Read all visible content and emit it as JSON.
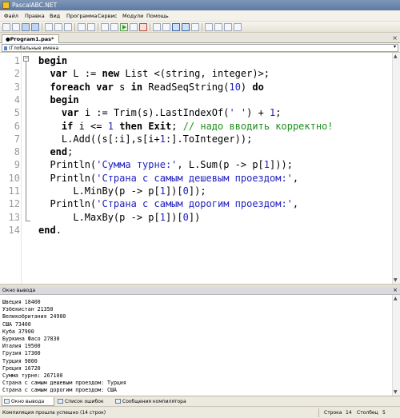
{
  "window": {
    "title": "PascalABC.NET"
  },
  "menu": [
    "Файл",
    "Правка",
    "Вид",
    "Программа",
    "Сервис",
    "Модули",
    "Помощь"
  ],
  "tab": {
    "label": "●Program1.pas*",
    "close": "×"
  },
  "scope": {
    "label": "(Глобальные имена",
    "arrow": "▾"
  },
  "editor": {
    "line_numbers": [
      "1",
      "2",
      "3",
      "4",
      "5",
      "6",
      "7",
      "8",
      "9",
      "10",
      "11",
      "12",
      "13",
      "14"
    ],
    "lines": [
      [
        {
          "t": "begin",
          "c": "kw"
        }
      ],
      [
        {
          "t": "  "
        },
        {
          "t": "var",
          "c": "kw"
        },
        {
          "t": " L := "
        },
        {
          "t": "new",
          "c": "kw"
        },
        {
          "t": " List <(string, integer)>;"
        }
      ],
      [
        {
          "t": "  "
        },
        {
          "t": "foreach",
          "c": "kw"
        },
        {
          "t": " "
        },
        {
          "t": "var",
          "c": "kw"
        },
        {
          "t": " s "
        },
        {
          "t": "in",
          "c": "kw"
        },
        {
          "t": " ReadSeqString("
        },
        {
          "t": "10",
          "c": "num"
        },
        {
          "t": ") "
        },
        {
          "t": "do",
          "c": "kw"
        }
      ],
      [
        {
          "t": "  "
        },
        {
          "t": "begin",
          "c": "kw"
        }
      ],
      [
        {
          "t": "    "
        },
        {
          "t": "var",
          "c": "kw"
        },
        {
          "t": " i := Trim(s).LastIndexOf("
        },
        {
          "t": "' '",
          "c": "str"
        },
        {
          "t": ") + "
        },
        {
          "t": "1",
          "c": "num"
        },
        {
          "t": ";"
        }
      ],
      [
        {
          "t": "    "
        },
        {
          "t": "if",
          "c": "kw"
        },
        {
          "t": " i <= "
        },
        {
          "t": "1",
          "c": "num"
        },
        {
          "t": " "
        },
        {
          "t": "then",
          "c": "kw"
        },
        {
          "t": " "
        },
        {
          "t": "Exit",
          "c": "exitkw"
        },
        {
          "t": "; "
        },
        {
          "t": "// надо вводить корректно!",
          "c": "cmt"
        }
      ],
      [
        {
          "t": "    L.Add((s[:i],s[i+"
        },
        {
          "t": "1",
          "c": "num"
        },
        {
          "t": ":].ToInteger));"
        }
      ],
      [
        {
          "t": "  "
        },
        {
          "t": "end",
          "c": "kw"
        },
        {
          "t": ";"
        }
      ],
      [
        {
          "t": "  Println("
        },
        {
          "t": "'Сумма турне:'",
          "c": "str"
        },
        {
          "t": ", L.Sum(p -> p["
        },
        {
          "t": "1",
          "c": "num"
        },
        {
          "t": "]));"
        }
      ],
      [
        {
          "t": "  Println("
        },
        {
          "t": "'Страна с самым дешевым проездом:'",
          "c": "str"
        },
        {
          "t": ","
        }
      ],
      [
        {
          "t": "      L.MinBy(p -> p["
        },
        {
          "t": "1",
          "c": "num"
        },
        {
          "t": "])["
        },
        {
          "t": "0",
          "c": "num"
        },
        {
          "t": "]);"
        }
      ],
      [
        {
          "t": "  Println("
        },
        {
          "t": "'Страна с самым дорогим проездом:'",
          "c": "str"
        },
        {
          "t": ","
        }
      ],
      [
        {
          "t": "      L.MaxBy(p -> p["
        },
        {
          "t": "1",
          "c": "num"
        },
        {
          "t": "])["
        },
        {
          "t": "0",
          "c": "num"
        },
        {
          "t": "])"
        }
      ],
      [
        {
          "t": "end",
          "c": "kw"
        },
        {
          "t": "."
        }
      ]
    ]
  },
  "output": {
    "title": "Окно вывода",
    "close": "×",
    "lines": [
      "Швеция 18400",
      "Узбекистан 21350",
      "Великобритания 24900",
      "США 73400",
      "Куба 37900",
      "Буркина Фасо 27830",
      "Италия 19500",
      "Грузия 17300",
      "Турция 9800",
      "Греция 16720",
      "Сумма турне: 267100",
      "Страна с самым дешевым проездом: Турция",
      "Страна с самым дорогим проездом: США"
    ]
  },
  "bottom_tabs": [
    "Окно вывода",
    "Список ошибок",
    "Сообщения компилятора"
  ],
  "status": {
    "message": "Компиляция прошла успешно (14 строк)",
    "row_label": "Строка",
    "row_value": "14",
    "col_label": "Столбец",
    "col_value": "5"
  },
  "colors": {
    "keyword": "#000000",
    "string": "#2020c0",
    "comment": "#1e8f1e",
    "line_number": "#9a9a9a"
  }
}
